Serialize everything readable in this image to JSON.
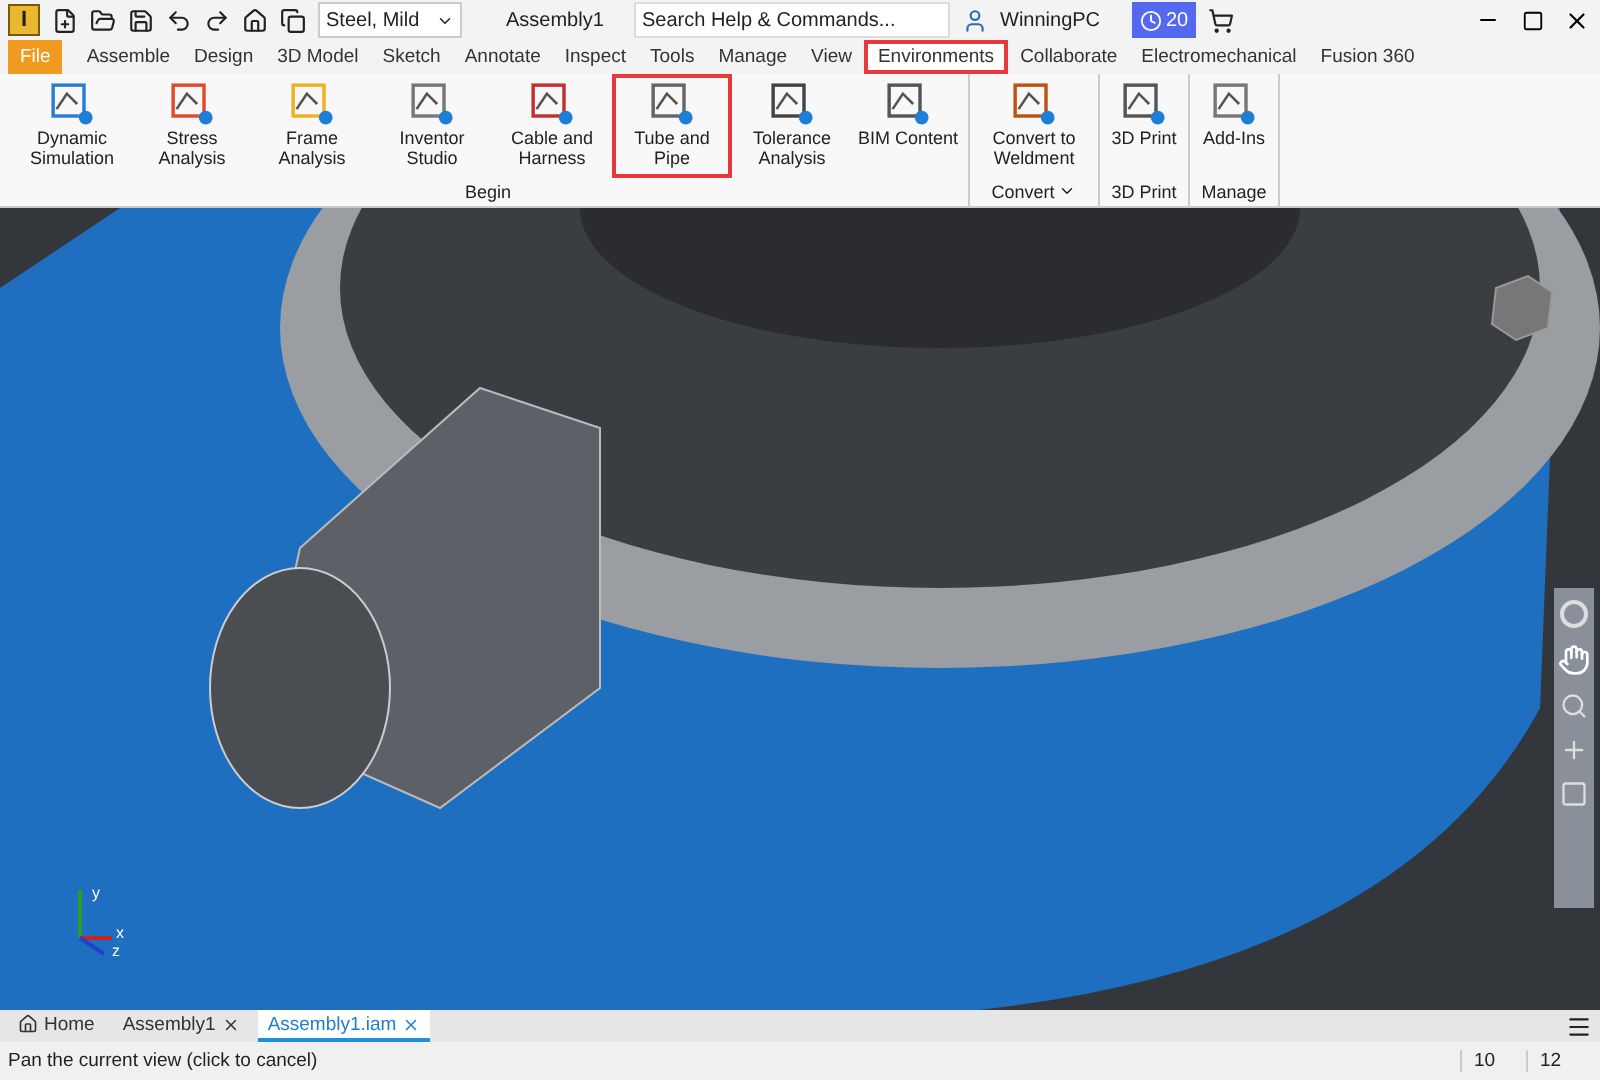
{
  "title_bar": {
    "app_letter": "I",
    "material": "Steel, Mild",
    "document": "Assembly1",
    "search": {
      "placeholder": "Search Help & Commands..."
    },
    "user": "WinningPC",
    "trial_days": "20"
  },
  "ribbon_tabs": [
    {
      "label": "File",
      "selected": false,
      "kind": "file",
      "highlighted": false
    },
    {
      "label": "Assemble",
      "selected": false,
      "kind": "tab",
      "highlighted": false
    },
    {
      "label": "Design",
      "selected": false,
      "kind": "tab",
      "highlighted": false
    },
    {
      "label": "3D Model",
      "selected": false,
      "kind": "tab",
      "highlighted": false
    },
    {
      "label": "Sketch",
      "selected": false,
      "kind": "tab",
      "highlighted": false
    },
    {
      "label": "Annotate",
      "selected": false,
      "kind": "tab",
      "highlighted": false
    },
    {
      "label": "Inspect",
      "selected": false,
      "kind": "tab",
      "highlighted": false
    },
    {
      "label": "Tools",
      "selected": false,
      "kind": "tab",
      "highlighted": false
    },
    {
      "label": "Manage",
      "selected": false,
      "kind": "tab",
      "highlighted": false
    },
    {
      "label": "View",
      "selected": false,
      "kind": "tab",
      "highlighted": false
    },
    {
      "label": "Environments",
      "selected": true,
      "kind": "tab",
      "highlighted": true
    },
    {
      "label": "Collaborate",
      "selected": false,
      "kind": "tab",
      "highlighted": false
    },
    {
      "label": "Electromechanical",
      "selected": false,
      "kind": "tab",
      "highlighted": false
    },
    {
      "label": "Fusion 360",
      "selected": false,
      "kind": "tab",
      "highlighted": false
    }
  ],
  "ribbon_groups": [
    {
      "label": "Begin",
      "dropdown": false,
      "buttons": [
        {
          "label": "Dynamic Simulation",
          "highlighted": false
        },
        {
          "label": "Stress Analysis",
          "highlighted": false
        },
        {
          "label": "Frame Analysis",
          "highlighted": false
        },
        {
          "label": "Inventor Studio",
          "highlighted": false
        },
        {
          "label": "Cable and Harness",
          "highlighted": false
        },
        {
          "label": "Tube and Pipe",
          "highlighted": true
        },
        {
          "label": "Tolerance Analysis",
          "highlighted": false
        },
        {
          "label": "BIM Content",
          "highlighted": false
        }
      ]
    },
    {
      "label": "Convert",
      "dropdown": true,
      "buttons": [
        {
          "label": "Convert to Weldment",
          "highlighted": false
        }
      ]
    },
    {
      "label": "3D Print",
      "dropdown": false,
      "buttons": [
        {
          "label": "3D Print",
          "highlighted": false
        }
      ]
    },
    {
      "label": "Manage",
      "dropdown": false,
      "buttons": [
        {
          "label": "Add-Ins",
          "highlighted": false
        }
      ]
    }
  ],
  "viewport": {
    "axes": [
      "x",
      "y",
      "z"
    ]
  },
  "document_tabs": [
    {
      "label": "Home",
      "selected": false,
      "kind": "home"
    },
    {
      "label": "Assembly1",
      "selected": false,
      "kind": "doc"
    },
    {
      "label": "Assembly1.iam",
      "selected": true,
      "kind": "doc"
    }
  ],
  "status_bar": {
    "message": "Pan the current view (click to cancel)",
    "fields": [
      "10",
      "12"
    ]
  }
}
